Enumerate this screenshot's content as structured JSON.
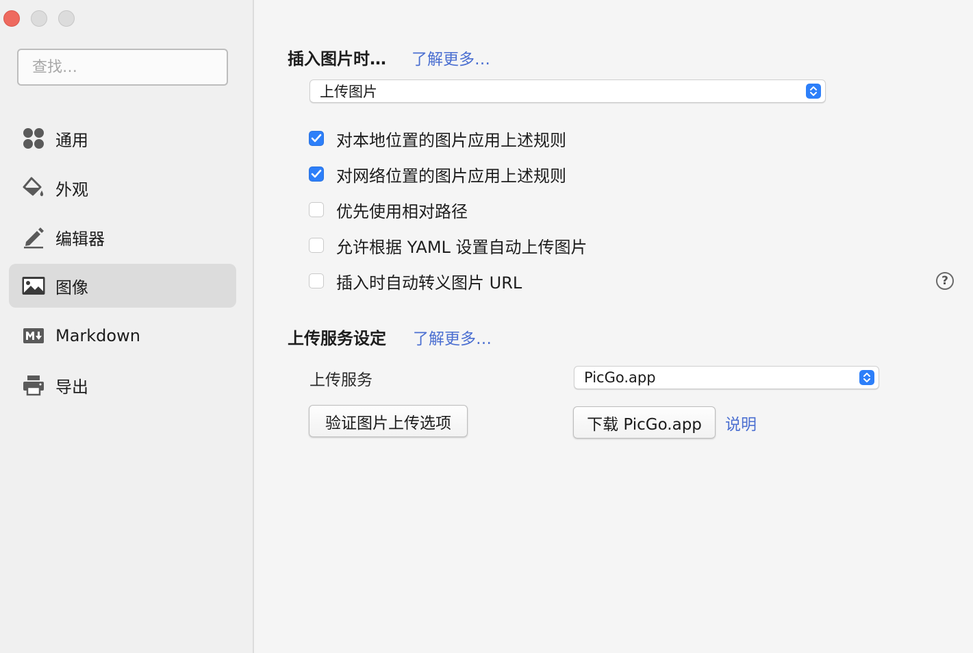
{
  "window": {
    "controls": [
      "close",
      "minimize",
      "maximize"
    ]
  },
  "sidebar": {
    "search_placeholder": "查找…",
    "items": [
      {
        "label": "通用",
        "icon": "grid-icon",
        "active": false
      },
      {
        "label": "外观",
        "icon": "paint-bucket-icon",
        "active": false
      },
      {
        "label": "编辑器",
        "icon": "pencil-icon",
        "active": false
      },
      {
        "label": "图像",
        "icon": "image-icon",
        "active": true
      },
      {
        "label": "Markdown",
        "icon": "markdown-icon",
        "active": false
      },
      {
        "label": "导出",
        "icon": "printer-icon",
        "active": false
      }
    ]
  },
  "insert_section": {
    "title": "插入图片时…",
    "learn_more": "了解更多…",
    "action_select": "上传图片",
    "options": [
      {
        "label": "对本地位置的图片应用上述规则",
        "checked": true
      },
      {
        "label": "对网络位置的图片应用上述规则",
        "checked": true
      },
      {
        "label": "优先使用相对路径",
        "checked": false
      },
      {
        "label": "允许根据 YAML 设置自动上传图片",
        "checked": false
      },
      {
        "label": "插入时自动转义图片 URL",
        "checked": false
      }
    ],
    "help_label": "?"
  },
  "upload_section": {
    "title": "上传服务设定",
    "learn_more": "了解更多…",
    "service_label": "上传服务",
    "service_select": "PicGo.app",
    "verify_button": "验证图片上传选项",
    "download_button": "下载 PicGo.app",
    "explain_link": "说明"
  },
  "colors": {
    "accent": "#2d7ff9",
    "link": "#4b6fd1",
    "close_button": "#ee6a5f",
    "active_item_bg": "#dcdcdc"
  }
}
